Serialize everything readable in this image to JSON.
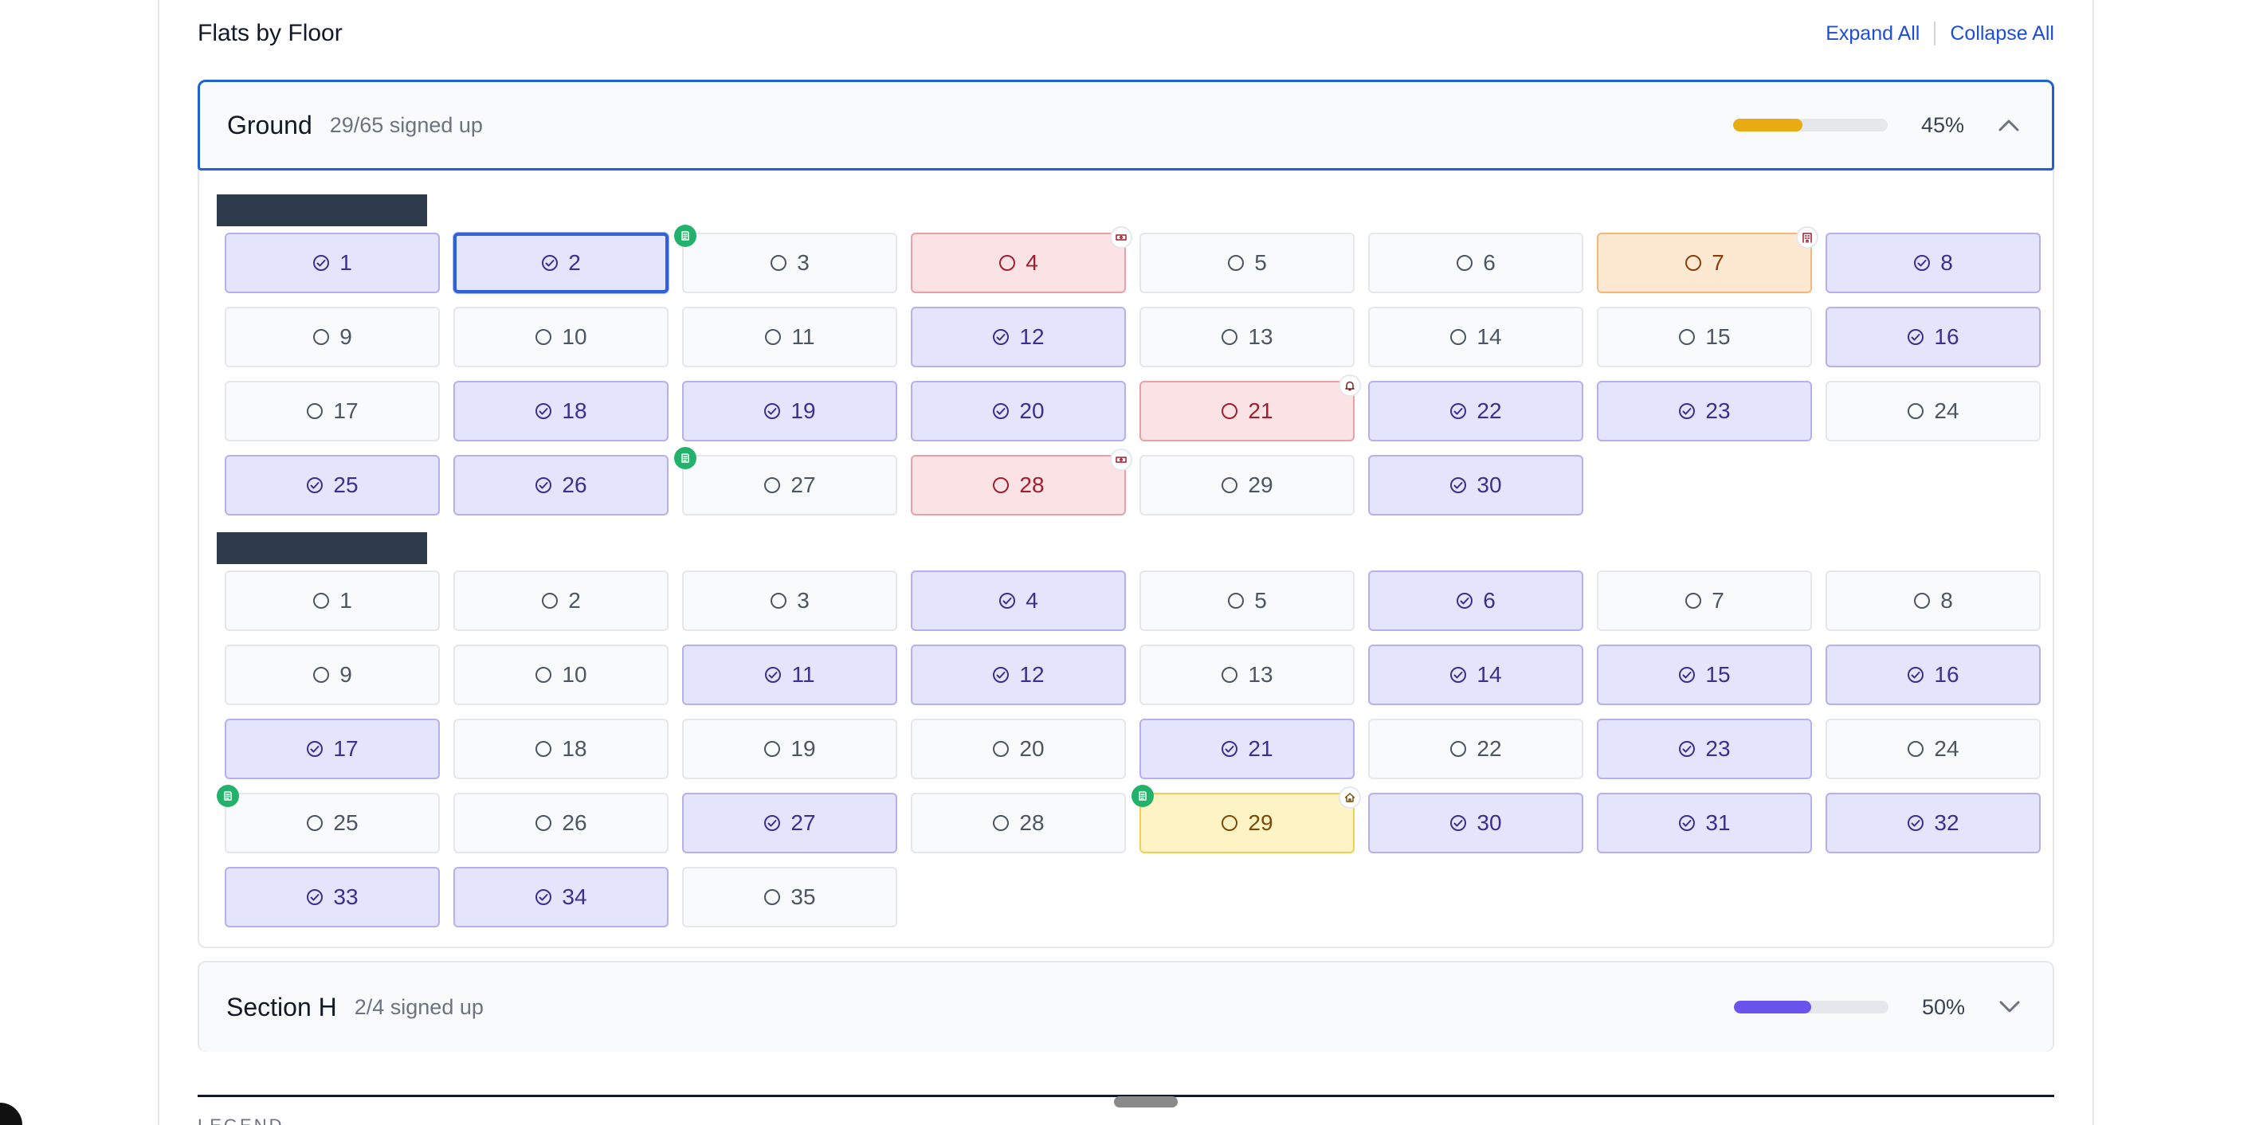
{
  "header": {
    "title": "Flats by Floor",
    "expand_all": "Expand All",
    "collapse_all": "Collapse All"
  },
  "floors": [
    {
      "name": "Ground",
      "subtitle": "29/65 signed up",
      "percent": "45%",
      "progress": 0.45,
      "progress_color": "#e6ac12",
      "expanded": true,
      "chevron": "chevron-up-icon"
    },
    {
      "name": "Section H",
      "subtitle": "2/4 signed up",
      "percent": "50%",
      "progress": 0.5,
      "progress_color": "#6b54ee",
      "expanded": false,
      "chevron": "chevron-down-icon"
    }
  ],
  "blocks": [
    {
      "flats": [
        {
          "n": "1",
          "s": "signed"
        },
        {
          "n": "2",
          "s": "signed",
          "selected": true
        },
        {
          "n": "3",
          "s": "open",
          "badge_left": "doc-icon"
        },
        {
          "n": "4",
          "s": "alert",
          "badge_right": "ticket-icon"
        },
        {
          "n": "5",
          "s": "open"
        },
        {
          "n": "6",
          "s": "open"
        },
        {
          "n": "7",
          "s": "warn",
          "badge_right": "building-icon"
        },
        {
          "n": "8",
          "s": "signed"
        },
        {
          "n": "9",
          "s": "open"
        },
        {
          "n": "10",
          "s": "open"
        },
        {
          "n": "11",
          "s": "open"
        },
        {
          "n": "12",
          "s": "signed"
        },
        {
          "n": "13",
          "s": "open"
        },
        {
          "n": "14",
          "s": "open"
        },
        {
          "n": "15",
          "s": "open"
        },
        {
          "n": "16",
          "s": "signed"
        },
        {
          "n": "17",
          "s": "open"
        },
        {
          "n": "18",
          "s": "signed"
        },
        {
          "n": "19",
          "s": "signed"
        },
        {
          "n": "20",
          "s": "signed"
        },
        {
          "n": "21",
          "s": "alert",
          "badge_right": "bell-icon"
        },
        {
          "n": "22",
          "s": "signed"
        },
        {
          "n": "23",
          "s": "signed"
        },
        {
          "n": "24",
          "s": "open"
        },
        {
          "n": "25",
          "s": "signed"
        },
        {
          "n": "26",
          "s": "signed"
        },
        {
          "n": "27",
          "s": "open",
          "badge_left": "doc-icon"
        },
        {
          "n": "28",
          "s": "alert",
          "badge_right": "ticket-icon"
        },
        {
          "n": "29",
          "s": "open"
        },
        {
          "n": "30",
          "s": "signed"
        }
      ]
    },
    {
      "flats": [
        {
          "n": "1",
          "s": "open"
        },
        {
          "n": "2",
          "s": "open"
        },
        {
          "n": "3",
          "s": "open"
        },
        {
          "n": "4",
          "s": "signed"
        },
        {
          "n": "5",
          "s": "open"
        },
        {
          "n": "6",
          "s": "signed"
        },
        {
          "n": "7",
          "s": "open"
        },
        {
          "n": "8",
          "s": "open"
        },
        {
          "n": "9",
          "s": "open"
        },
        {
          "n": "10",
          "s": "open"
        },
        {
          "n": "11",
          "s": "signed"
        },
        {
          "n": "12",
          "s": "signed"
        },
        {
          "n": "13",
          "s": "open"
        },
        {
          "n": "14",
          "s": "signed"
        },
        {
          "n": "15",
          "s": "signed"
        },
        {
          "n": "16",
          "s": "signed"
        },
        {
          "n": "17",
          "s": "signed"
        },
        {
          "n": "18",
          "s": "open"
        },
        {
          "n": "19",
          "s": "open"
        },
        {
          "n": "20",
          "s": "open"
        },
        {
          "n": "21",
          "s": "signed"
        },
        {
          "n": "22",
          "s": "open"
        },
        {
          "n": "23",
          "s": "signed"
        },
        {
          "n": "24",
          "s": "open"
        },
        {
          "n": "25",
          "s": "open",
          "badge_left": "doc-icon"
        },
        {
          "n": "26",
          "s": "open"
        },
        {
          "n": "27",
          "s": "signed"
        },
        {
          "n": "28",
          "s": "open"
        },
        {
          "n": "29",
          "s": "home",
          "badge_left": "doc-icon",
          "badge_right": "house-icon"
        },
        {
          "n": "30",
          "s": "signed"
        },
        {
          "n": "31",
          "s": "signed"
        },
        {
          "n": "32",
          "s": "signed"
        },
        {
          "n": "33",
          "s": "signed"
        },
        {
          "n": "34",
          "s": "signed"
        },
        {
          "n": "35",
          "s": "open"
        }
      ]
    }
  ],
  "legend": {
    "label": "LEGEND"
  }
}
